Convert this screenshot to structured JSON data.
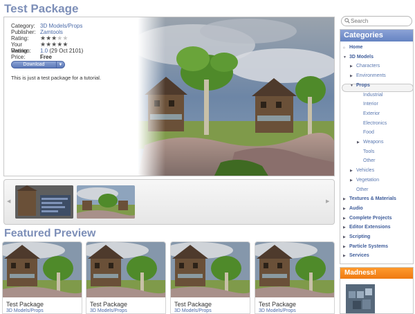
{
  "page": {
    "title": "Test Package"
  },
  "search": {
    "placeholder": "Search"
  },
  "package": {
    "fields": [
      {
        "label": "Category:",
        "value": "3D Models/Props",
        "link": true
      },
      {
        "label": "Publisher:",
        "value": "Zamtools",
        "link": true
      },
      {
        "label": "Rating:",
        "stars": 3,
        "max": 5
      },
      {
        "label": "Your Rating:",
        "stars": 5,
        "max": 5
      },
      {
        "label": "Version:",
        "version": "1.0",
        "date": "(29 Oct 2101)"
      },
      {
        "label": "Price:",
        "value": "Free",
        "bold": true
      }
    ],
    "download_label": "Download",
    "description": "This is just a test package for a tutorial."
  },
  "thumbnails": {
    "count": 2
  },
  "featured": {
    "heading": "Featured Preview",
    "cards": [
      {
        "title": "Test Package",
        "subtitle": "3D Models/Props"
      },
      {
        "title": "Test Package",
        "subtitle": "3D Models/Props"
      },
      {
        "title": "Test Package",
        "subtitle": "3D Models/Props"
      },
      {
        "title": "Test Package",
        "subtitle": "3D Models/Props"
      }
    ]
  },
  "categories": {
    "heading": "Categories",
    "items": [
      {
        "label": "Home",
        "icon": "home",
        "style": "bold",
        "depth": 0
      },
      {
        "label": "3D Models",
        "icon": "open",
        "style": "bold",
        "depth": 0
      },
      {
        "label": "Characters",
        "icon": "closed",
        "style": "sub",
        "depth": 1
      },
      {
        "label": "Environments",
        "icon": "closed",
        "style": "sub",
        "depth": 1
      },
      {
        "label": "Props",
        "icon": "open",
        "style": "bold",
        "depth": 1,
        "selected": true
      },
      {
        "label": "Industrial",
        "icon": "none",
        "style": "sub",
        "depth": 2
      },
      {
        "label": "Interior",
        "icon": "none",
        "style": "sub",
        "depth": 2
      },
      {
        "label": "Exterior",
        "icon": "none",
        "style": "sub",
        "depth": 2
      },
      {
        "label": "Electronics",
        "icon": "none",
        "style": "sub",
        "depth": 2
      },
      {
        "label": "Food",
        "icon": "none",
        "style": "sub",
        "depth": 2
      },
      {
        "label": "Weapons",
        "icon": "closed",
        "style": "sub",
        "depth": 2
      },
      {
        "label": "Tools",
        "icon": "none",
        "style": "sub",
        "depth": 2
      },
      {
        "label": "Other",
        "icon": "none",
        "style": "sub",
        "depth": 2
      },
      {
        "label": "Vehicles",
        "icon": "closed",
        "style": "sub",
        "depth": 1
      },
      {
        "label": "Vegetation",
        "icon": "closed",
        "style": "sub",
        "depth": 1
      },
      {
        "label": "Other",
        "icon": "none",
        "style": "sub",
        "depth": 1
      },
      {
        "label": "Textures & Materials",
        "icon": "closed",
        "style": "bold",
        "depth": 0
      },
      {
        "label": "Audio",
        "icon": "closed",
        "style": "bold",
        "depth": 0
      },
      {
        "label": "Complete Projects",
        "icon": "closed",
        "style": "bold",
        "depth": 0
      },
      {
        "label": "Editor Extensions",
        "icon": "closed",
        "style": "bold",
        "depth": 0
      },
      {
        "label": "Scripting",
        "icon": "closed",
        "style": "bold",
        "depth": 0
      },
      {
        "label": "Particle Systems",
        "icon": "closed",
        "style": "bold",
        "depth": 0
      },
      {
        "label": "Services",
        "icon": "closed",
        "style": "bold",
        "depth": 0
      }
    ]
  },
  "promo": {
    "heading": "Madness!"
  },
  "colors": {
    "heading": "#7d8fb8",
    "link": "#4a6aa8",
    "category_header": "#6f8cc8",
    "promo": "#f58a1f"
  }
}
